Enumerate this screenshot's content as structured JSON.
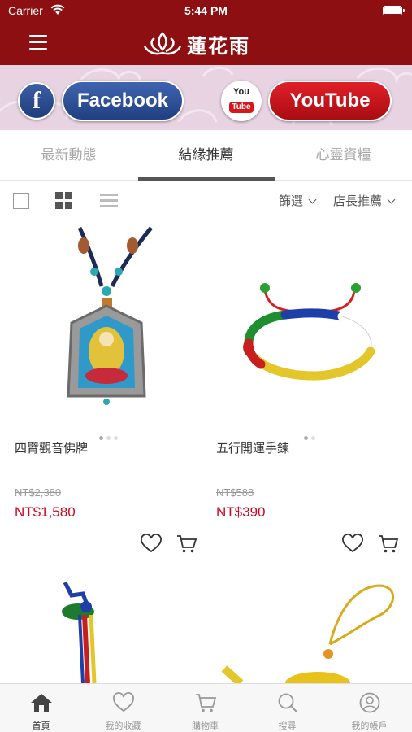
{
  "status_bar": {
    "carrier": "Carrier",
    "time": "5:44 PM"
  },
  "nav": {
    "brand": "蓮花雨"
  },
  "social": {
    "facebook_icon": "f",
    "facebook_label": "Facebook",
    "youtube_icon_you": "You",
    "youtube_icon_tube": "Tube",
    "youtube_label": "YouTube"
  },
  "tabs": [
    {
      "label": "最新動態"
    },
    {
      "label": "結緣推薦"
    },
    {
      "label": "心靈資糧"
    }
  ],
  "filters": {
    "filter_label": "篩選",
    "sort_label": "店長推薦"
  },
  "products": [
    {
      "name": "四臂觀音佛牌",
      "original_price": "NT$2,380",
      "price": "NT$1,580"
    },
    {
      "name": "五行開運手鍊",
      "original_price": "NT$588",
      "price": "NT$390"
    }
  ],
  "bottom_tabs": [
    {
      "label": "首頁"
    },
    {
      "label": "我的收藏"
    },
    {
      "label": "購物車"
    },
    {
      "label": "搜尋"
    },
    {
      "label": "我的帳戶"
    }
  ],
  "colors": {
    "brand_red": "#8d0f11",
    "price_red": "#d0021b",
    "facebook_blue": "#2d4e96",
    "youtube_red": "#d9161c"
  },
  "icons": [
    "wifi-icon",
    "battery-icon",
    "hamburger-icon",
    "lotus-logo-icon",
    "facebook-icon",
    "youtube-icon",
    "grid-view-icon",
    "list-view-icon",
    "chevron-down-icon",
    "heart-icon",
    "cart-icon",
    "home-icon",
    "search-icon",
    "user-icon"
  ]
}
